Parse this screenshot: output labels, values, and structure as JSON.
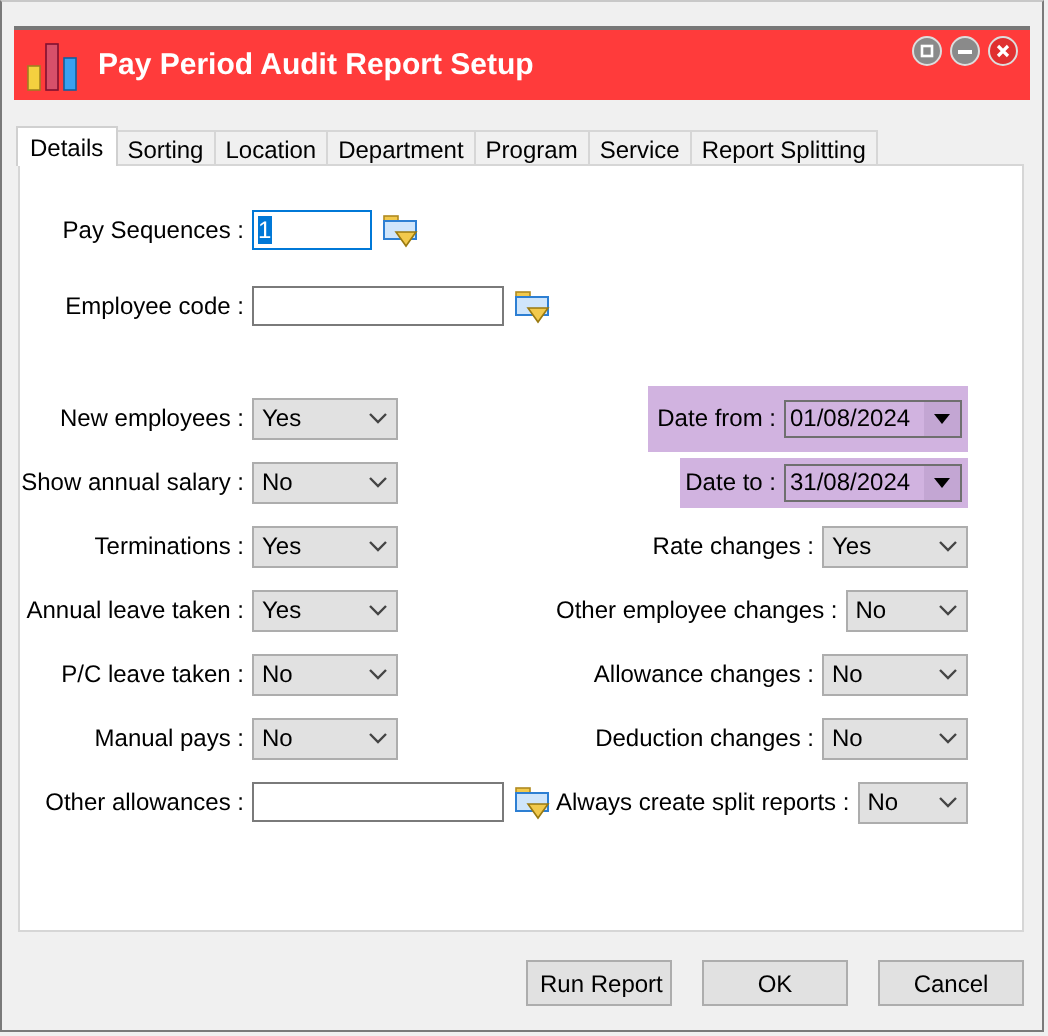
{
  "window": {
    "title": "Pay Period Audit Report Setup"
  },
  "tabs": [
    {
      "label": "Details",
      "selected": true
    },
    {
      "label": "Sorting",
      "selected": false
    },
    {
      "label": "Location",
      "selected": false
    },
    {
      "label": "Department",
      "selected": false
    },
    {
      "label": "Program",
      "selected": false
    },
    {
      "label": "Service",
      "selected": false
    },
    {
      "label": "Report Splitting",
      "selected": false
    }
  ],
  "lookup_fields": [
    {
      "label": "Pay Sequences :",
      "value": "1",
      "focused": true,
      "kind": "short"
    },
    {
      "label": "Employee code :",
      "focused": false,
      "kind": "long"
    }
  ],
  "left_fields": [
    {
      "kind": "dropdown",
      "label": "New employees :",
      "value": "Yes"
    },
    {
      "kind": "dropdown",
      "label": "Show annual salary :",
      "value": "No"
    },
    {
      "kind": "dropdown",
      "label": "Terminations :",
      "value": "Yes"
    },
    {
      "kind": "dropdown",
      "label": "Annual leave taken :",
      "value": "Yes"
    },
    {
      "kind": "dropdown",
      "label": "P/C leave taken :",
      "value": "No"
    },
    {
      "kind": "dropdown",
      "label": "Manual pays :",
      "value": "No"
    },
    {
      "kind": "lookup",
      "label": "Other allowances :"
    }
  ],
  "right_fields": [
    {
      "kind": "date",
      "label": "Date from :",
      "value": "01/08/2024",
      "highlighted": true
    },
    {
      "kind": "date",
      "label": "Date to :",
      "value": "31/08/2024",
      "highlighted": true
    },
    {
      "kind": "dropdown",
      "label": "Rate changes :",
      "value": "Yes"
    },
    {
      "kind": "dropdown",
      "label": "Other employee changes :",
      "value": "No"
    },
    {
      "kind": "dropdown",
      "label": "Allowance changes :",
      "value": "No"
    },
    {
      "kind": "dropdown",
      "label": "Deduction changes :",
      "value": "No"
    },
    {
      "kind": "dropdown",
      "label": "Always create split reports :",
      "value": "No"
    }
  ],
  "buttons": [
    "Run Report",
    "OK",
    "Cancel"
  ]
}
